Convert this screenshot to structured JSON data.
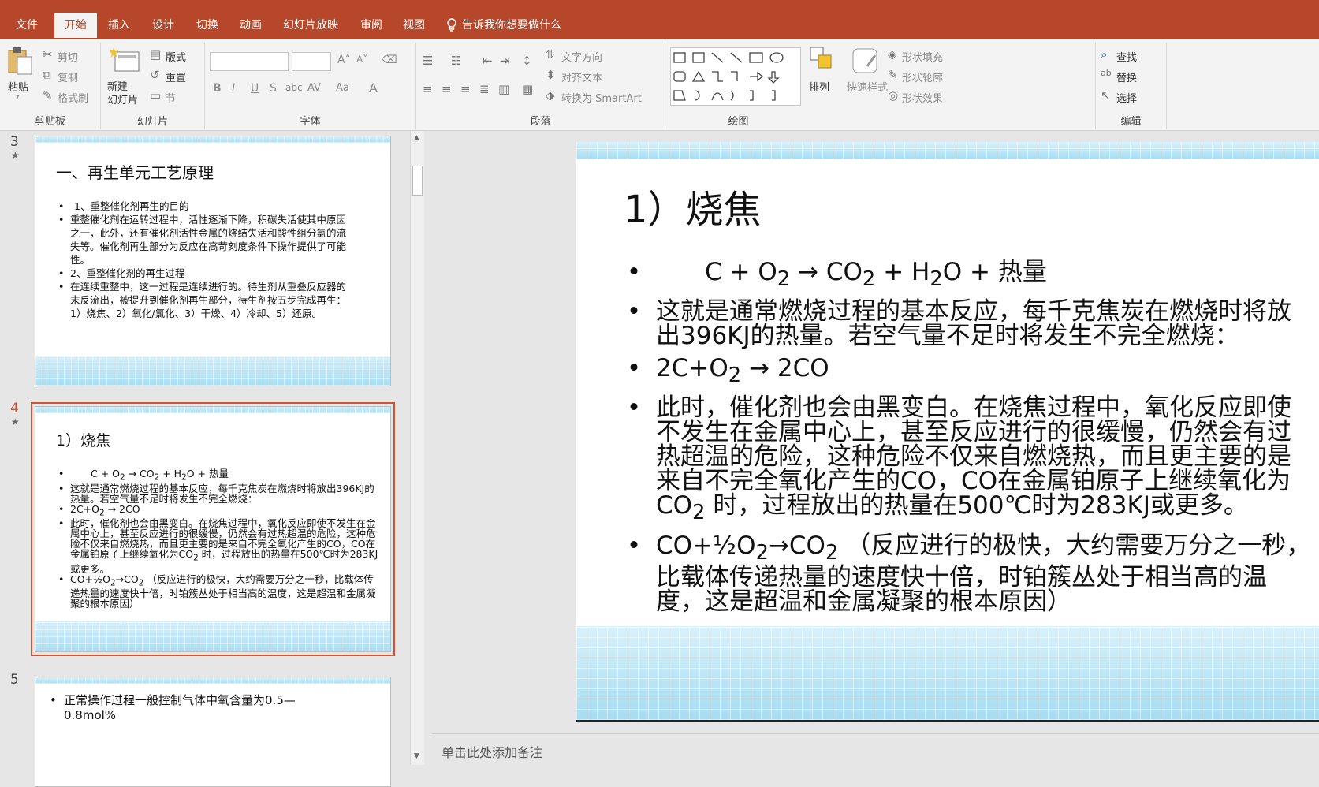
{
  "ribbon_tabs": [
    "文件",
    "开始",
    "插入",
    "设计",
    "切换",
    "动画",
    "幻灯片放映",
    "审阅",
    "视图"
  ],
  "tell_me": "告诉我你想要做什么",
  "clipboard": {
    "paste": "粘贴",
    "cut": "剪切",
    "copy": "复制",
    "format_painter": "格式刷",
    "label": "剪贴板"
  },
  "slides_group": {
    "new_slide": "新建\n幻灯片",
    "layout": "版式",
    "reset": "重置",
    "section": "节",
    "label": "幻灯片"
  },
  "font_group": {
    "label": "字体"
  },
  "paragraph": {
    "text_direction": "文字方向",
    "align_text": "对齐文本",
    "convert_smartart": "转换为 SmartArt",
    "label": "段落"
  },
  "drawing": {
    "arrange": "排列",
    "quick_styles": "快速样式",
    "shape_fill": "形状填充",
    "shape_outline": "形状轮廓",
    "shape_effects": "形状效果",
    "label": "绘图"
  },
  "editing": {
    "find": "查找",
    "replace": "替换",
    "select": "选择",
    "label": "编辑"
  },
  "thumbnails": [
    {
      "number": "3",
      "title": "一、再生单元工艺原理",
      "bullets": [
        "1、重整催化剂再生的目的",
        "重整催化剂在运转过程中，活性逐渐下降，积碳失活使其中原因之一，此外，还有催化剂活性金属的烧结失活和酸性组分氯的流失等。催化剂再生部分为反应在高苛刻度条件下操作提供了可能性。",
        "2、重整催化剂的再生过程",
        "在连续重整中，这一过程是连续进行的。待生剂从重叠反应器的末反流出，被提升到催化剂再生部分，待生剂按五步完成再生：1）烧焦、2）氧化/氯化、3）干燥、4）冷却、5）还原。"
      ]
    },
    {
      "number": "4",
      "title": "1）烧焦"
    },
    {
      "number": "5",
      "bullets": [
        "正常操作过程一般控制气体中氧含量为0.5—0.8mol%"
      ]
    }
  ],
  "slide": {
    "title": "1）烧焦",
    "eq1": {
      "a": "C + O",
      "b": "2",
      "c": " → CO",
      "d": "2",
      "e": " + H",
      "f": "2",
      "g": "O + 热量"
    },
    "b2": "这就是通常燃烧过程的基本反应，每千克焦炭在燃烧时将放出396KJ的热量。若空气量不足时将发生不完全燃烧：",
    "eq3": {
      "a": "2C+O",
      "b": "2",
      "c": " → 2CO"
    },
    "b4": {
      "a": "此时，催化剂也会由黑变白。在烧焦过程中，氧化反应即使不发生在金属中心上，甚至反应进行的很缓慢，仍然会有过热超温的危险，这种危险不仅来自燃烧热，而且更主要的是来自不完全氧化产生的CO，CO在金属铂原子上继续氧化为CO",
      "b": "2",
      "c": " 时，过程放出的热量在500℃时为283KJ或更多。"
    },
    "b5": {
      "a": "CO+½O",
      "b": "2",
      "c": "→CO",
      "d": "2",
      "e": " （反应进行的极快，大约需要万分之一秒，比载体传递热量的速度快十倍，时铂簇丛处于相当高的温度，这是超温和金属凝聚的根本原因）"
    }
  },
  "notes_placeholder": "单击此处添加备注",
  "colors": {
    "accent": "#b7472a",
    "selection": "#d35230"
  }
}
